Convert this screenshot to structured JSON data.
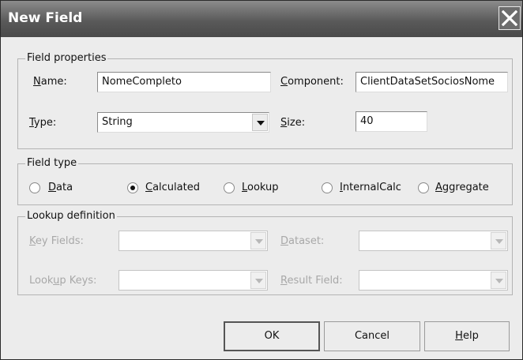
{
  "window": {
    "title": "New Field"
  },
  "field_properties": {
    "group_title": "Field properties",
    "name_label": "Name:",
    "name_value": "NomeCompleto",
    "component_label": "Component:",
    "component_value": "ClientDataSetSociosNome",
    "type_label": "Type:",
    "type_value": "String",
    "size_label": "Size:",
    "size_value": "40"
  },
  "field_type": {
    "group_title": "Field type",
    "options": [
      {
        "label": "Data",
        "selected": false
      },
      {
        "label": "Calculated",
        "selected": true
      },
      {
        "label": "Lookup",
        "selected": false
      },
      {
        "label": "InternalCalc",
        "selected": false
      },
      {
        "label": "Aggregate",
        "selected": false
      }
    ]
  },
  "lookup_definition": {
    "group_title": "Lookup definition",
    "key_fields_label": "Key Fields:",
    "dataset_label": "Dataset:",
    "lookup_keys_label": "Lookup Keys:",
    "result_field_label": "Result Field:",
    "enabled": false
  },
  "buttons": {
    "ok": "OK",
    "cancel": "Cancel",
    "help": "Help"
  },
  "icons": {
    "close": "close-icon",
    "dropdown": "chevron-down-icon",
    "radio": "radio-button"
  },
  "colors": {
    "titlebar": "#5a5a5a",
    "dialog_bg": "#ececec",
    "disabled_text": "#a8a8a8"
  }
}
